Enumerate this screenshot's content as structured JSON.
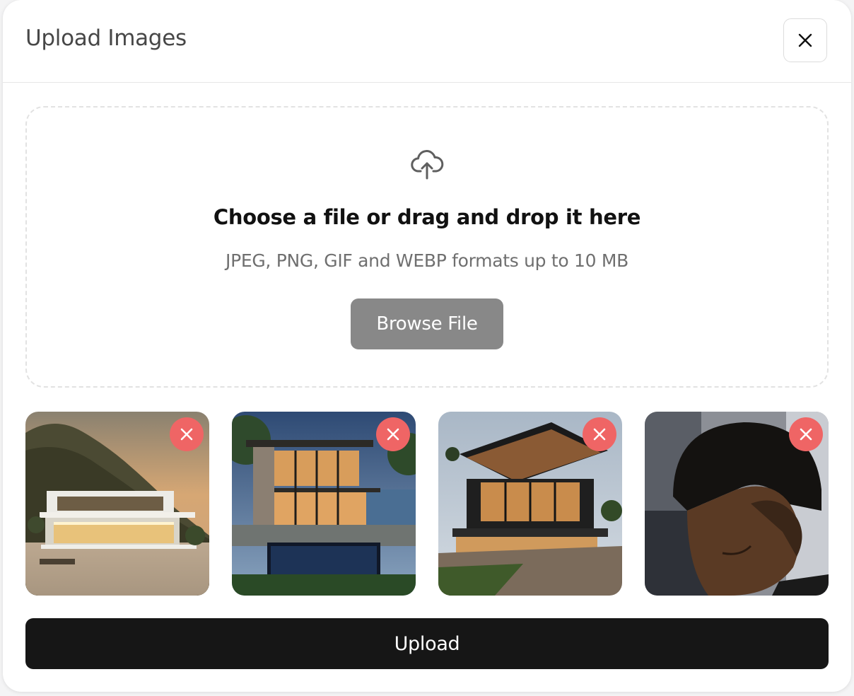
{
  "header": {
    "title": "Upload Images",
    "close_icon": "close-icon"
  },
  "dropzone": {
    "icon": "cloud-upload-icon",
    "heading": "Choose a file or drag and drop it here",
    "subtext": "JPEG, PNG, GIF and WEBP formats up to 10 MB",
    "browse_label": "Browse File"
  },
  "thumbnails": [
    {
      "subject": "modern white beach house at sunset",
      "remove_icon": "remove-icon"
    },
    {
      "subject": "glass villa with pool by the sea at dusk",
      "remove_icon": "remove-icon"
    },
    {
      "subject": "dark timber modern house with wooden deck",
      "remove_icon": "remove-icon"
    },
    {
      "subject": "boy with high-top fade haircut",
      "remove_icon": "remove-icon"
    }
  ],
  "footer": {
    "upload_label": "Upload"
  },
  "colors": {
    "primary_button": "#161616",
    "secondary_button": "#888888",
    "remove_badge": "#ef6565"
  }
}
